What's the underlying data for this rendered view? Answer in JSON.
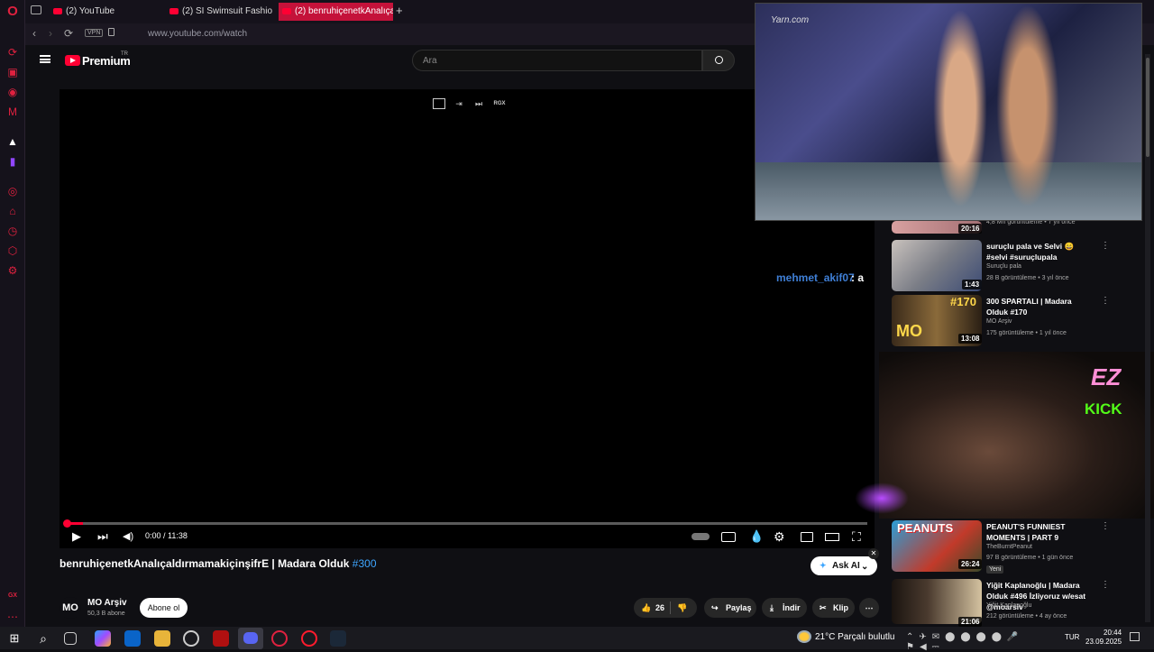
{
  "browser": {
    "tabs": [
      {
        "label": "(2) YouTube"
      },
      {
        "label": "(2) SI Swimsuit Fashion S"
      },
      {
        "label": "(2) benruhiçenetkAnalıçal"
      }
    ],
    "vpn_label": "VPN",
    "url": "www.youtube.com/watch",
    "sidebar_bottom_label": "GX"
  },
  "youtube": {
    "logo_text": "Premium",
    "logo_sup": "TR",
    "search_placeholder": "Ara",
    "player": {
      "mini_badge": "RGX",
      "time": "0:00 / 11:38",
      "progress_fraction": 0.02
    },
    "video": {
      "title": "benruhiçenetkAnalıçaldırmamakiçinşifrE | Madara Olduk ",
      "title_tag": "#300",
      "ask_ai": "Ask AI",
      "channel_avatar": "MO",
      "channel_name": "MO Arşiv",
      "channel_subs": "50,3 B abone",
      "subscribe": "Abone ol",
      "likes": "26",
      "share": "Paylaş",
      "download": "İndir",
      "clip": "Klip"
    },
    "chat": {
      "user": "mehmet_akif07",
      "message": ": a"
    },
    "pip_watermark": "Yarn.com",
    "recommendations": [
      {
        "title": "",
        "channel": "",
        "meta": "4,8 Mn görüntüleme • 7 yıl önce",
        "duration": "20:16"
      },
      {
        "title": "suruçlu pala ve Selvi 😄 #selvi #suruçlupala",
        "channel": "Suruçlu pala",
        "meta": "28 B görüntüleme • 3 yıl önce",
        "duration": "1:43"
      },
      {
        "title": "300 SPARTALI | Madara Olduk #170",
        "channel": "MO Arşiv",
        "meta": "175 görüntüleme • 1 yıl önce",
        "duration": "13:08",
        "thumb_text": "#170"
      },
      {
        "title": "PEANUT'S FUNNIEST MOMENTS | PART 9",
        "channel": "TheBurntPeanut",
        "meta": "97 B görüntüleme • 1 gün önce",
        "badge": "Yeni",
        "duration": "26:24"
      },
      {
        "title": "Yiğit Kaplanoğlu | Madara Olduk #496 İzliyoruz w/esat @moarsiv",
        "channel": "Yiğit Kaplanoğlu",
        "meta": "212 görüntüleme • 4 ay önce",
        "duration": "21:06"
      }
    ],
    "overlay": {
      "ez": "EZ",
      "kick": "KICK"
    }
  },
  "taskbar": {
    "weather": "21°C  Parçalı bulutlu",
    "lang": "TUR",
    "time": "20:44",
    "date": "23.09.2025"
  },
  "colors": {
    "accent": "#ff0033",
    "opera": "#e0213f",
    "link": "#3ea6ff"
  }
}
